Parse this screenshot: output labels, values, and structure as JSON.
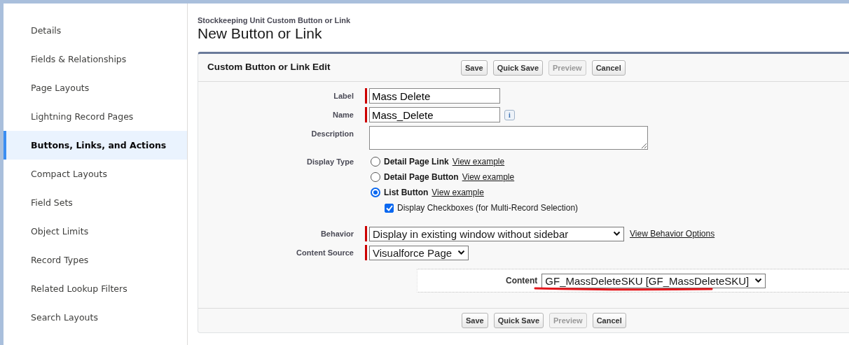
{
  "sidebar": {
    "items": [
      {
        "label": "Details",
        "selected": false
      },
      {
        "label": "Fields & Relationships",
        "selected": false
      },
      {
        "label": "Page Layouts",
        "selected": false
      },
      {
        "label": "Lightning Record Pages",
        "selected": false
      },
      {
        "label": "Buttons, Links, and Actions",
        "selected": true
      },
      {
        "label": "Compact Layouts",
        "selected": false
      },
      {
        "label": "Field Sets",
        "selected": false
      },
      {
        "label": "Object Limits",
        "selected": false
      },
      {
        "label": "Record Types",
        "selected": false
      },
      {
        "label": "Related Lookup Filters",
        "selected": false
      },
      {
        "label": "Search Layouts",
        "selected": false
      }
    ]
  },
  "header": {
    "breadcrumb": "Stockkeeping Unit Custom Button or Link",
    "title": "New Button or Link"
  },
  "panel": {
    "title": "Custom Button or Link Edit",
    "buttons": [
      {
        "label": "Save",
        "disabled": false
      },
      {
        "label": "Quick Save",
        "disabled": false
      },
      {
        "label": "Preview",
        "disabled": true
      },
      {
        "label": "Cancel",
        "disabled": false
      }
    ],
    "fields": [
      {
        "kind": "text",
        "label": "Label",
        "required": true,
        "value": "Mass Delete"
      },
      {
        "kind": "text",
        "label": "Name",
        "required": true,
        "value": "Mass_Delete",
        "info": "i"
      },
      {
        "kind": "textarea",
        "label": "Description"
      },
      {
        "kind": "radio",
        "label": "Display Type",
        "options": [
          {
            "label": "Detail Page Link",
            "link": "View example",
            "selected": false
          },
          {
            "label": "Detail Page Button",
            "link": "View example",
            "selected": false
          },
          {
            "label": "List Button",
            "link": "View example",
            "selected": true
          }
        ],
        "checkbox": {
          "label": "Display Checkboxes (for Multi-Record Selection)",
          "checked": true
        }
      },
      {
        "kind": "select",
        "label": "Behavior",
        "required": true,
        "value": "Display in existing window without sidebar",
        "link": "View Behavior Options",
        "wide": true
      },
      {
        "kind": "select",
        "label": "Content Source",
        "required": true,
        "value": "Visualforce Page"
      }
    ],
    "content": {
      "label": "Content",
      "value": "GF_MassDeleteSKU [GF_MassDeleteSKU]"
    },
    "footer_buttons": [
      {
        "label": "Save",
        "disabled": false
      },
      {
        "label": "Quick Save",
        "disabled": false
      },
      {
        "label": "Preview",
        "disabled": true
      },
      {
        "label": "Cancel",
        "disabled": false
      }
    ]
  }
}
